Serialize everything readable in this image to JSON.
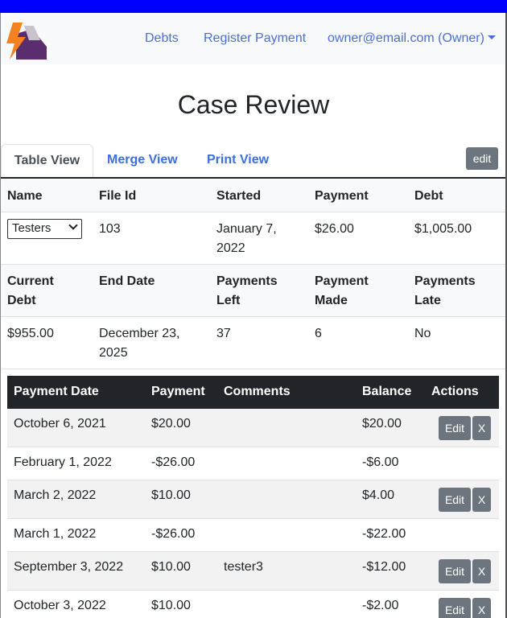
{
  "navbar": {
    "links": [
      "Debts",
      "Register Payment"
    ],
    "user_menu": "owner@email.com (Owner)",
    "logo_icon": "lightning-bolt-logo-icon"
  },
  "page": {
    "title": "Case Review"
  },
  "tabs": {
    "items": [
      "Table View",
      "Merge View",
      "Print View"
    ],
    "active": "Table View",
    "edit_label": "edit"
  },
  "summary": {
    "row1_headers": [
      "Name",
      "File Id",
      "Started",
      "Payment",
      "Debt"
    ],
    "name_select": "Testers",
    "file_id": "103",
    "started": "January 7,\n2022",
    "payment": "$26.00",
    "debt": "$1,005.00",
    "row2_headers": [
      "Current\nDebt",
      "End Date",
      "Payments\nLeft",
      "Payment\nMade",
      "Payments\nLate"
    ],
    "current_debt": "$955.00",
    "end_date": "December 23,\n2025",
    "payments_left": "37",
    "payment_made": "6",
    "payments_late": "No"
  },
  "payments": {
    "headers": [
      "Payment Date",
      "Payment",
      "Comments",
      "Balance",
      "Actions"
    ],
    "edit_label": "Edit",
    "delete_label": "X",
    "rows": [
      {
        "date": "October 6, 2021",
        "payment": "$20.00",
        "comments": "",
        "balance": "$20.00",
        "actions": true
      },
      {
        "date": "February 1, 2022",
        "payment": "-$26.00",
        "comments": "",
        "balance": "-$6.00",
        "actions": false
      },
      {
        "date": "March 2, 2022",
        "payment": "$10.00",
        "comments": "",
        "balance": "$4.00",
        "actions": true
      },
      {
        "date": "March 1, 2022",
        "payment": "-$26.00",
        "comments": "",
        "balance": "-$22.00",
        "actions": false
      },
      {
        "date": "September 3, 2022",
        "payment": "$10.00",
        "comments": "tester3",
        "balance": "-$12.00",
        "actions": true
      },
      {
        "date": "October 3, 2022",
        "payment": "$10.00",
        "comments": "",
        "balance": "-$2.00",
        "actions": true
      }
    ]
  },
  "colors": {
    "topbar": "#0000ff",
    "link": "#4a6fd6",
    "table_header": "#212529",
    "button": "#6c757d"
  }
}
